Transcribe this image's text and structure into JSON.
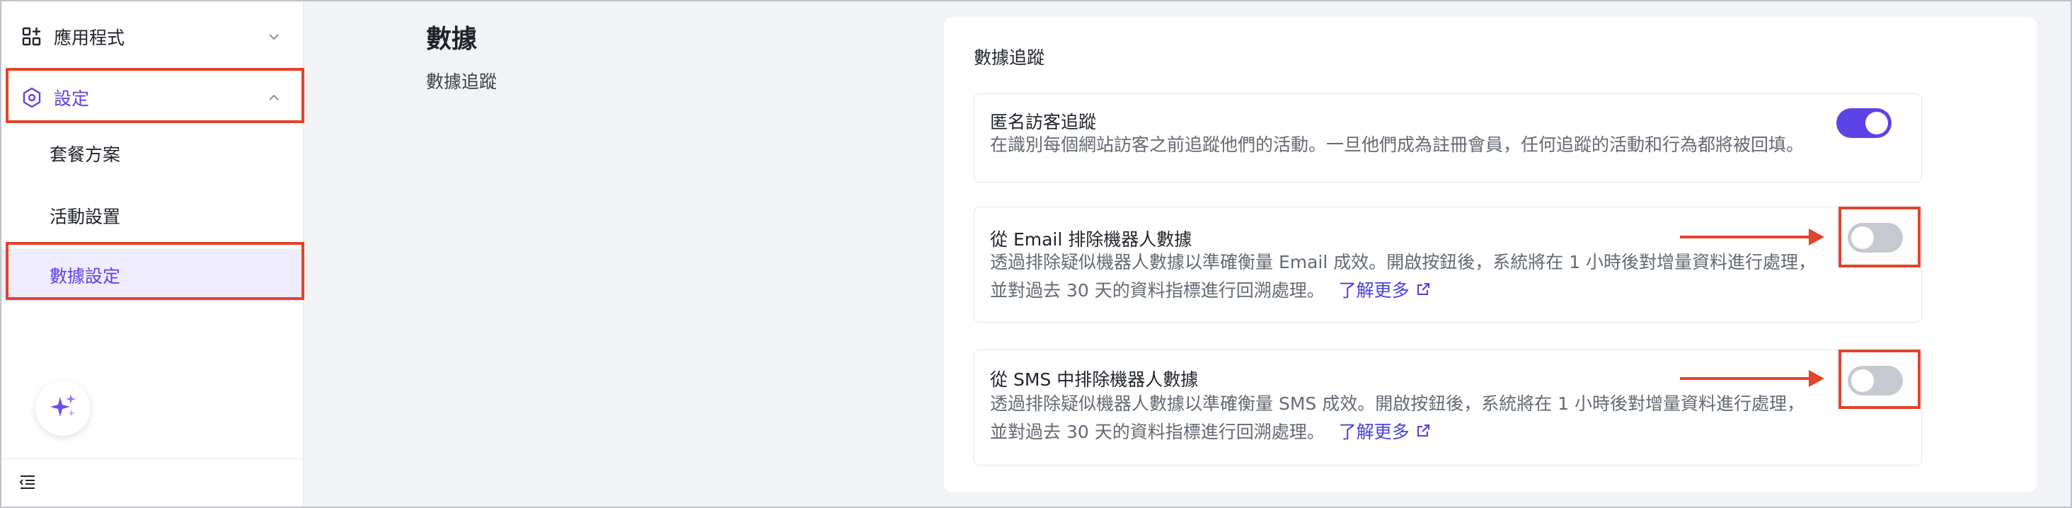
{
  "sidebar": {
    "apps": {
      "label": "應用程式",
      "icon": "apps-grid-icon"
    },
    "settings": {
      "label": "設定",
      "icon": "hexagon-settings-icon"
    },
    "sub_items": [
      {
        "label": "套餐方案"
      },
      {
        "label": "活動設置"
      },
      {
        "label": "數據設定"
      }
    ],
    "ai_button_icon": "sparkle-icon",
    "collapse_icon": "collapse-menu-icon"
  },
  "page": {
    "title": "數據",
    "subtitle": "數據追蹤"
  },
  "card": {
    "title": "數據追蹤",
    "rows": [
      {
        "title": "匿名訪客追蹤",
        "desc_line1": "在識別每個網站訪客之前追蹤他們的活動。一旦他們成為註冊會員，任何追蹤的活動和行為都將被回填。",
        "toggle": "on"
      },
      {
        "title": "從 Email 排除機器人數據",
        "desc_line1": "透過排除疑似機器人數據以準確衡量 Email 成效。開啟按鈕後，系統將在 1 小時後對增量資料進行處理，",
        "desc_line2": "並對過去 30 天的資料指標進行回溯處理。",
        "learn_more": "了解更多",
        "toggle": "off"
      },
      {
        "title": "從 SMS 中排除機器人數據",
        "desc_line1": "透過排除疑似機器人數據以準確衡量 SMS 成效。開啟按鈕後，系統將在 1 小時後對增量資料進行處理，",
        "desc_line2": "並對過去 30 天的資料指標進行回溯處理。",
        "learn_more": "了解更多",
        "toggle": "off"
      }
    ]
  },
  "colors": {
    "accent": "#5b43e6",
    "highlight": "#e0452b",
    "toggle_off": "#c6c9d0"
  }
}
